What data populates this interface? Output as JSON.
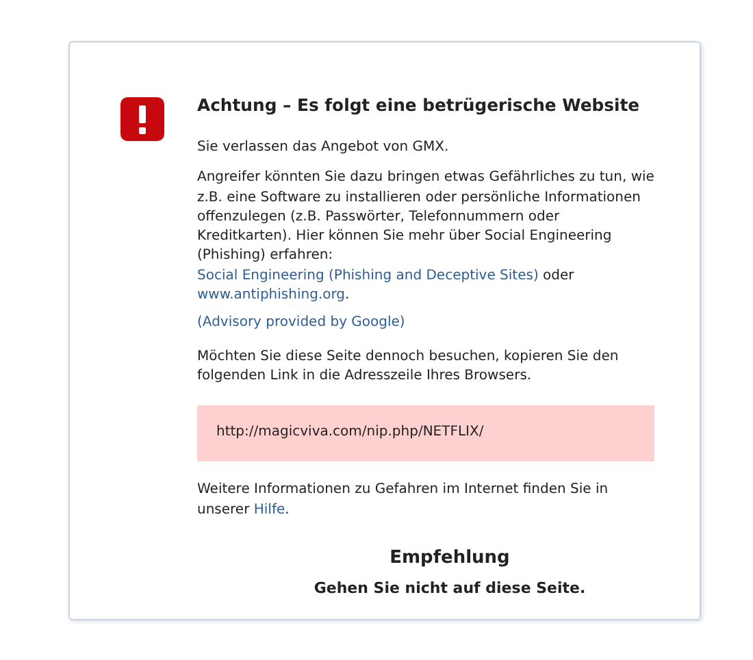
{
  "title": "Achtung – Es folgt eine betrügerische Website",
  "intro": "Sie verlassen das Angebot von GMX.",
  "explanation": {
    "text": "Angreifer könnten Sie dazu bringen etwas Gefährliches zu tun, wie z.B. eine Software zu installieren oder persönliche Informationen offenzulegen (z.B. Passwörter, Telefonnummern oder Kreditkarten). Hier können Sie mehr über Social Engineering (Phishing) erfahren: ",
    "link_1": "Social Engineering (Phishing and Deceptive Sites)",
    "between": " oder ",
    "link_2": "www.antiphishing.org",
    "end": "."
  },
  "advisory_link": "(Advisory provided by Google)",
  "copy_hint": "Möchten Sie diese Seite dennoch besuchen, kopieren Sie den folgenden Link in die Adresszeile Ihres Browsers.",
  "url": "http://magicviva.com/nip.php/NETFLIX/",
  "help": {
    "text": "Weitere Informationen zu Gefahren im Internet finden Sie in unserer ",
    "link": "Hilfe",
    "end": "."
  },
  "recommendation_title": "Empfehlung",
  "recommendation": "Gehen Sie nicht auf diese Seite."
}
